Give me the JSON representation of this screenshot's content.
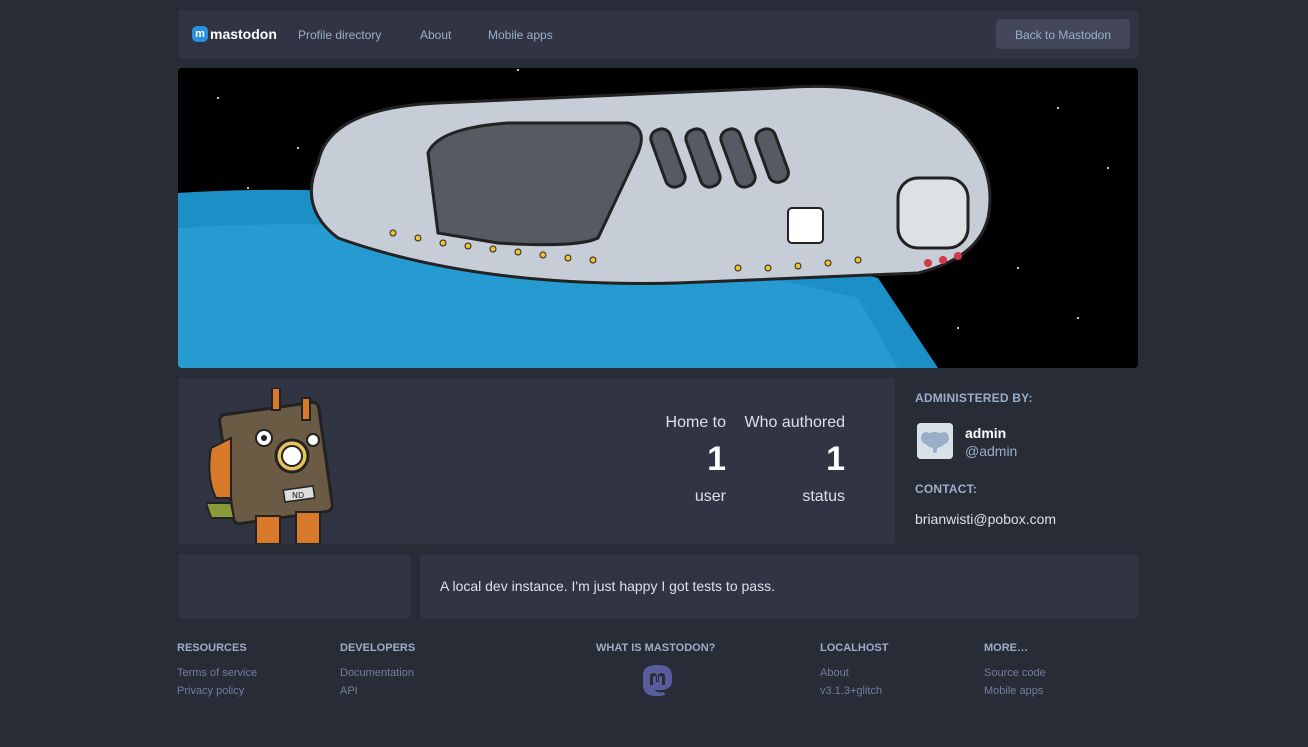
{
  "topbar": {
    "brand": "mastodon",
    "links": [
      "Profile directory",
      "About",
      "Mobile apps"
    ],
    "back_button": "Back to Mastodon"
  },
  "stats": {
    "users": {
      "label": "Home to",
      "value": "1",
      "unit": "user"
    },
    "statuses": {
      "label": "Who authored",
      "value": "1",
      "unit": "status"
    }
  },
  "sidebar": {
    "administered_by": "ADMINISTERED BY:",
    "admin_name": "admin",
    "admin_handle": "@admin",
    "contact_heading": "CONTACT:",
    "contact_email": "brianwisti@pobox.com"
  },
  "description": "A local dev instance. I'm just happy I got tests to pass.",
  "footer": {
    "resources": {
      "heading": "RESOURCES",
      "links": [
        "Terms of service",
        "Privacy policy"
      ]
    },
    "developers": {
      "heading": "DEVELOPERS",
      "links": [
        "Documentation",
        "API"
      ]
    },
    "what_is": {
      "heading": "WHAT IS MASTODON?"
    },
    "localhost": {
      "heading": "LOCALHOST",
      "links": [
        "About",
        "v3.1.3+glitch"
      ]
    },
    "more": {
      "heading": "MORE…",
      "links": [
        "Source code",
        "Mobile apps"
      ]
    }
  },
  "colors": {
    "background": "#282c37",
    "panel": "#313543",
    "accent": "#2b90d9",
    "muted": "#9baec8"
  },
  "icons": [
    "mastodon-logo-icon",
    "mastodon-footer-icon",
    "spaceship-hero-image",
    "robot-mascot-image",
    "elephant-avatar-icon"
  ]
}
